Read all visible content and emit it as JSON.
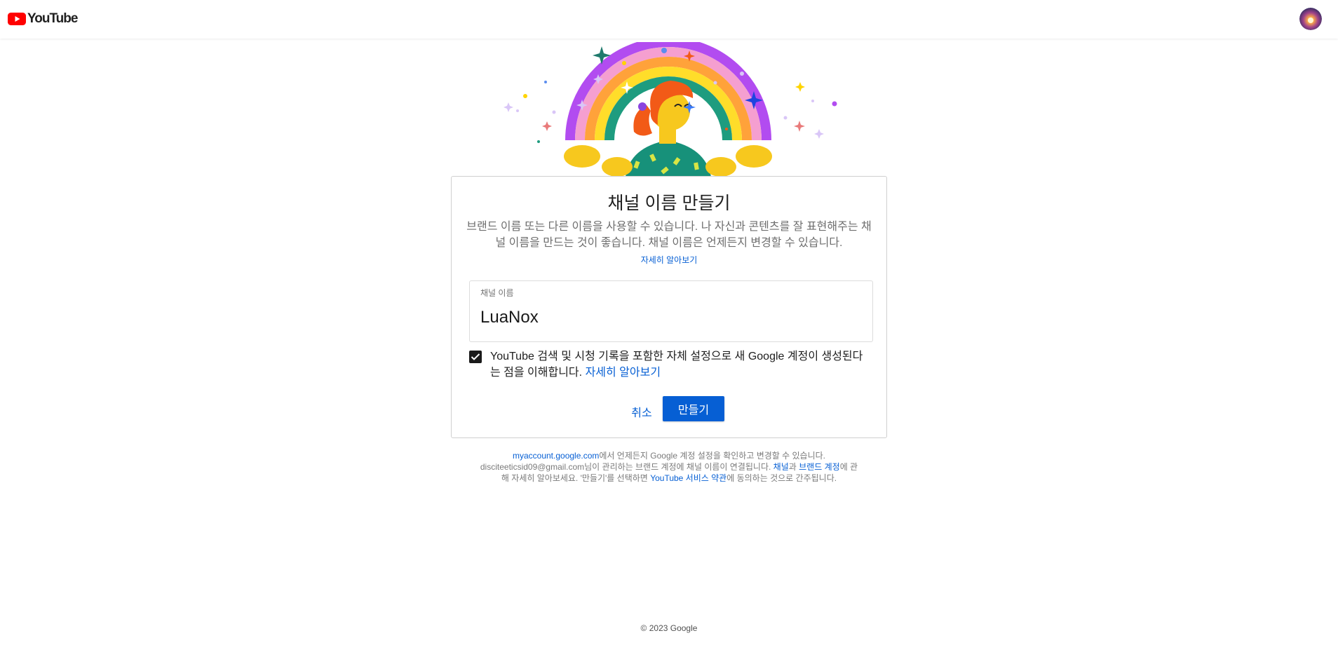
{
  "header": {
    "logo_text": "YouTube",
    "logo_icon": "youtube-play-icon",
    "avatar_icon": "account-avatar"
  },
  "hero": {
    "image": "rainbow-celebration-illustration"
  },
  "card": {
    "title": "채널 이름 만들기",
    "description": "브랜드 이름 또는 다른 이름을 사용할 수 있습니다. 나 자신과 콘텐츠를 잘 표현해주는 채널 이름을 만드는 것이 좋습니다. 채널 이름은 언제든지 변경할 수 있습니다.",
    "learn_more": "자세히 알아보기",
    "field_label": "채널 이름",
    "field_value": "LuaNox",
    "checkbox_checked": true,
    "checkbox_text": "YouTube 검색 및 시청 기록을 포함한 자체 설정으로 새 Google 계정이 생성된다는 점을 이해합니다.",
    "checkbox_link": "자세히 알아보기",
    "cancel_label": "취소",
    "create_label": "만들기",
    "accent_color": "#065fd4"
  },
  "footnote": {
    "account_link": "myaccount.google.com",
    "text1": "에서 언제든지 Google 계정 설정을 확인하고 변경할 수 있습니다. disciteeticsid09@gmail.com님이 관리하는 브랜드 계정에 채널 이름이 연결됩니다. ",
    "channel_link": "채널",
    "text2": "과 ",
    "brand_link": "브랜드 계정",
    "text3": "에 관해 자세히 알아보세요. '만들기'를 선택하면 ",
    "terms_link": "YouTube 서비스 약관",
    "text4": "에 동의하는 것으로 간주됩니다."
  },
  "copyright": "© 2023 Google"
}
